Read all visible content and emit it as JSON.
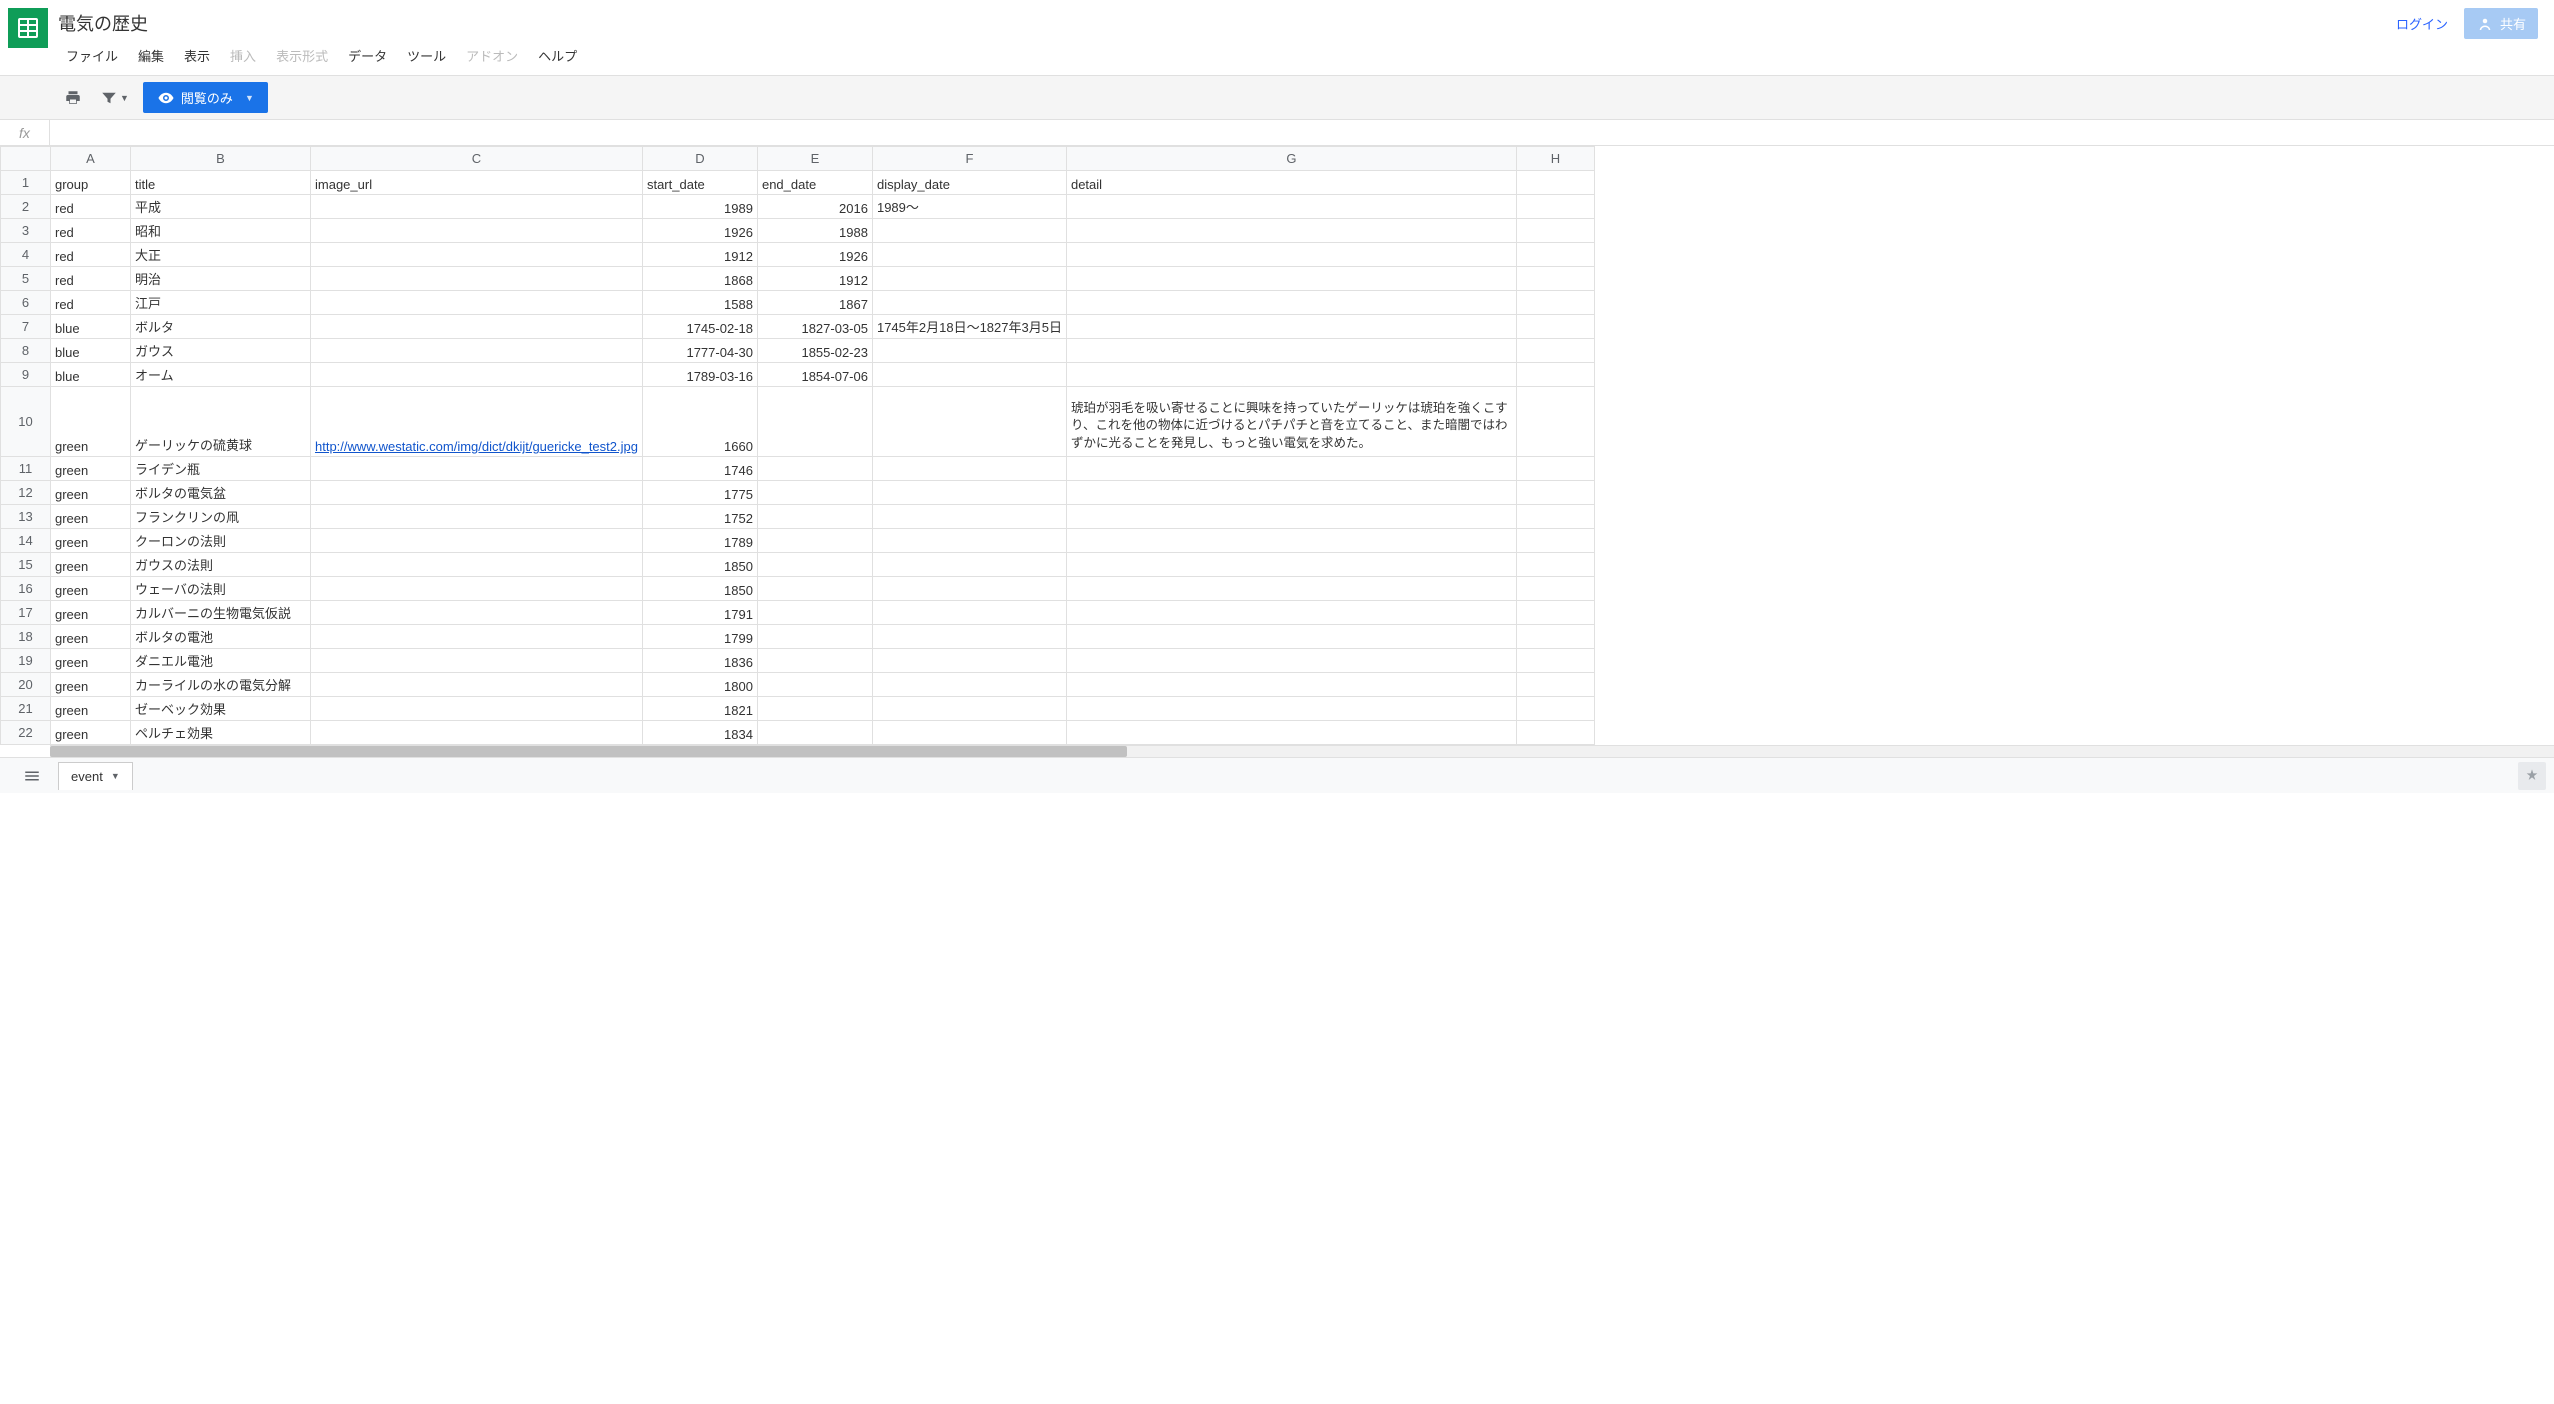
{
  "header": {
    "doc_title": "電気の歴史",
    "login": "ログイン",
    "share": "共有",
    "menus": [
      {
        "label": "ファイル",
        "enabled": true
      },
      {
        "label": "編集",
        "enabled": true
      },
      {
        "label": "表示",
        "enabled": true
      },
      {
        "label": "挿入",
        "enabled": false
      },
      {
        "label": "表示形式",
        "enabled": false
      },
      {
        "label": "データ",
        "enabled": true
      },
      {
        "label": "ツール",
        "enabled": true
      },
      {
        "label": "アドオン",
        "enabled": false
      },
      {
        "label": "ヘルプ",
        "enabled": true
      }
    ]
  },
  "toolbar": {
    "view_only": "閲覧のみ"
  },
  "formula_bar": {
    "fx": "fx",
    "value": ""
  },
  "columns": [
    "A",
    "B",
    "C",
    "D",
    "E",
    "F",
    "G",
    "H"
  ],
  "sheet": {
    "headers": {
      "A": "group",
      "B": "title",
      "C": "image_url",
      "D": "start_date",
      "E": "end_date",
      "F": "display_date",
      "G": "detail"
    },
    "rows": [
      {
        "n": 1,
        "A": "group",
        "B": "title",
        "C": "image_url",
        "D": "start_date",
        "E": "end_date",
        "F": "display_date",
        "G": "detail",
        "header": true
      },
      {
        "n": 2,
        "A": "red",
        "B": "平成",
        "D": "1989",
        "E": "2016",
        "F": "1989〜"
      },
      {
        "n": 3,
        "A": "red",
        "B": "昭和",
        "D": "1926",
        "E": "1988"
      },
      {
        "n": 4,
        "A": "red",
        "B": "大正",
        "D": "1912",
        "E": "1926"
      },
      {
        "n": 5,
        "A": "red",
        "B": "明治",
        "D": "1868",
        "E": "1912"
      },
      {
        "n": 6,
        "A": "red",
        "B": "江戸",
        "D": "1588",
        "E": "1867"
      },
      {
        "n": 7,
        "A": "blue",
        "B": "ボルタ",
        "D": "1745-02-18",
        "E": "1827-03-05",
        "F": "1745年2月18日〜1827年3月5日"
      },
      {
        "n": 8,
        "A": "blue",
        "B": "ガウス",
        "D": "1777-04-30",
        "E": "1855-02-23"
      },
      {
        "n": 9,
        "A": "blue",
        "B": "オーム",
        "D": "1789-03-16",
        "E": "1854-07-06"
      },
      {
        "n": 10,
        "A": "green",
        "B": "ゲーリッケの硫黄球",
        "C": "http://www.westatic.com/img/dict/dkijt/guericke_test2.jpg",
        "D": "1660",
        "G": " 琥珀が羽毛を吸い寄せることに興味を持っていたゲーリッケは琥珀を強くこすり、これを他の物体に近づけるとパチパチと音を立てること、また暗闇ではわずかに光ることを発見し、もっと強い電気を求めた。",
        "tall": true,
        "link": true
      },
      {
        "n": 11,
        "A": "green",
        "B": "ライデン瓶",
        "D": "1746"
      },
      {
        "n": 12,
        "A": "green",
        "B": "ボルタの電気盆",
        "D": "1775"
      },
      {
        "n": 13,
        "A": "green",
        "B": "フランクリンの凧",
        "D": "1752"
      },
      {
        "n": 14,
        "A": "green",
        "B": "クーロンの法則",
        "D": "1789"
      },
      {
        "n": 15,
        "A": "green",
        "B": "ガウスの法則",
        "D": "1850"
      },
      {
        "n": 16,
        "A": "green",
        "B": "ウェーバの法則",
        "D": "1850"
      },
      {
        "n": 17,
        "A": "green",
        "B": "カルバーニの生物電気仮説",
        "D": "1791"
      },
      {
        "n": 18,
        "A": "green",
        "B": "ボルタの電池",
        "D": "1799"
      },
      {
        "n": 19,
        "A": "green",
        "B": "ダニエル電池",
        "D": "1836"
      },
      {
        "n": 20,
        "A": "green",
        "B": "カーライルの水の電気分解",
        "D": "1800"
      },
      {
        "n": 21,
        "A": "green",
        "B": "ゼーベック効果",
        "D": "1821"
      },
      {
        "n": 22,
        "A": "green",
        "B": "ペルチェ効果",
        "D": "1834"
      }
    ]
  },
  "footer": {
    "tab": "event"
  }
}
